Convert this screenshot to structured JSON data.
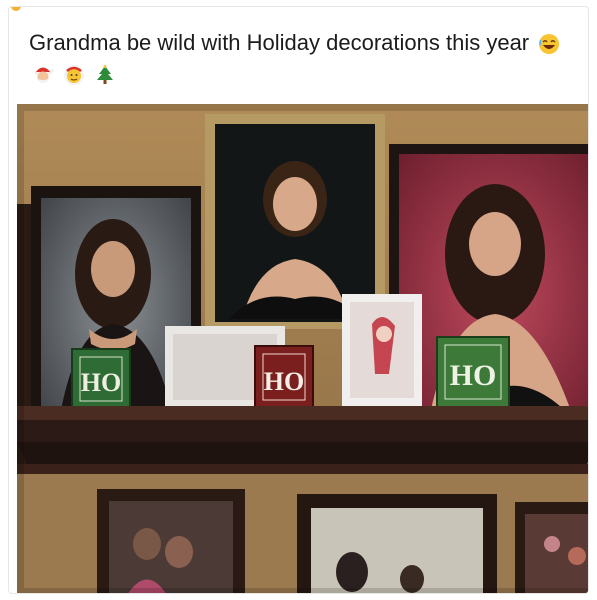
{
  "post": {
    "caption": "Grandma be wild with Holiday decorations this year",
    "caption_emojis": [
      "laughing-face-emoji",
      "santa-face-emoji",
      "mrs-claus-face-emoji",
      "christmas-tree-emoji"
    ]
  },
  "photo": {
    "blocks": [
      {
        "label": "HO",
        "color": "#2f6b34"
      },
      {
        "label": "HO",
        "color": "#7a1f1e"
      },
      {
        "label": "HO",
        "color": "#3d7a3a"
      }
    ]
  },
  "colors": {
    "wall": "#a4804f",
    "shelf": "#2b1a15",
    "frame_dark": "#1e1512",
    "frame_gold": "#b59a63"
  }
}
